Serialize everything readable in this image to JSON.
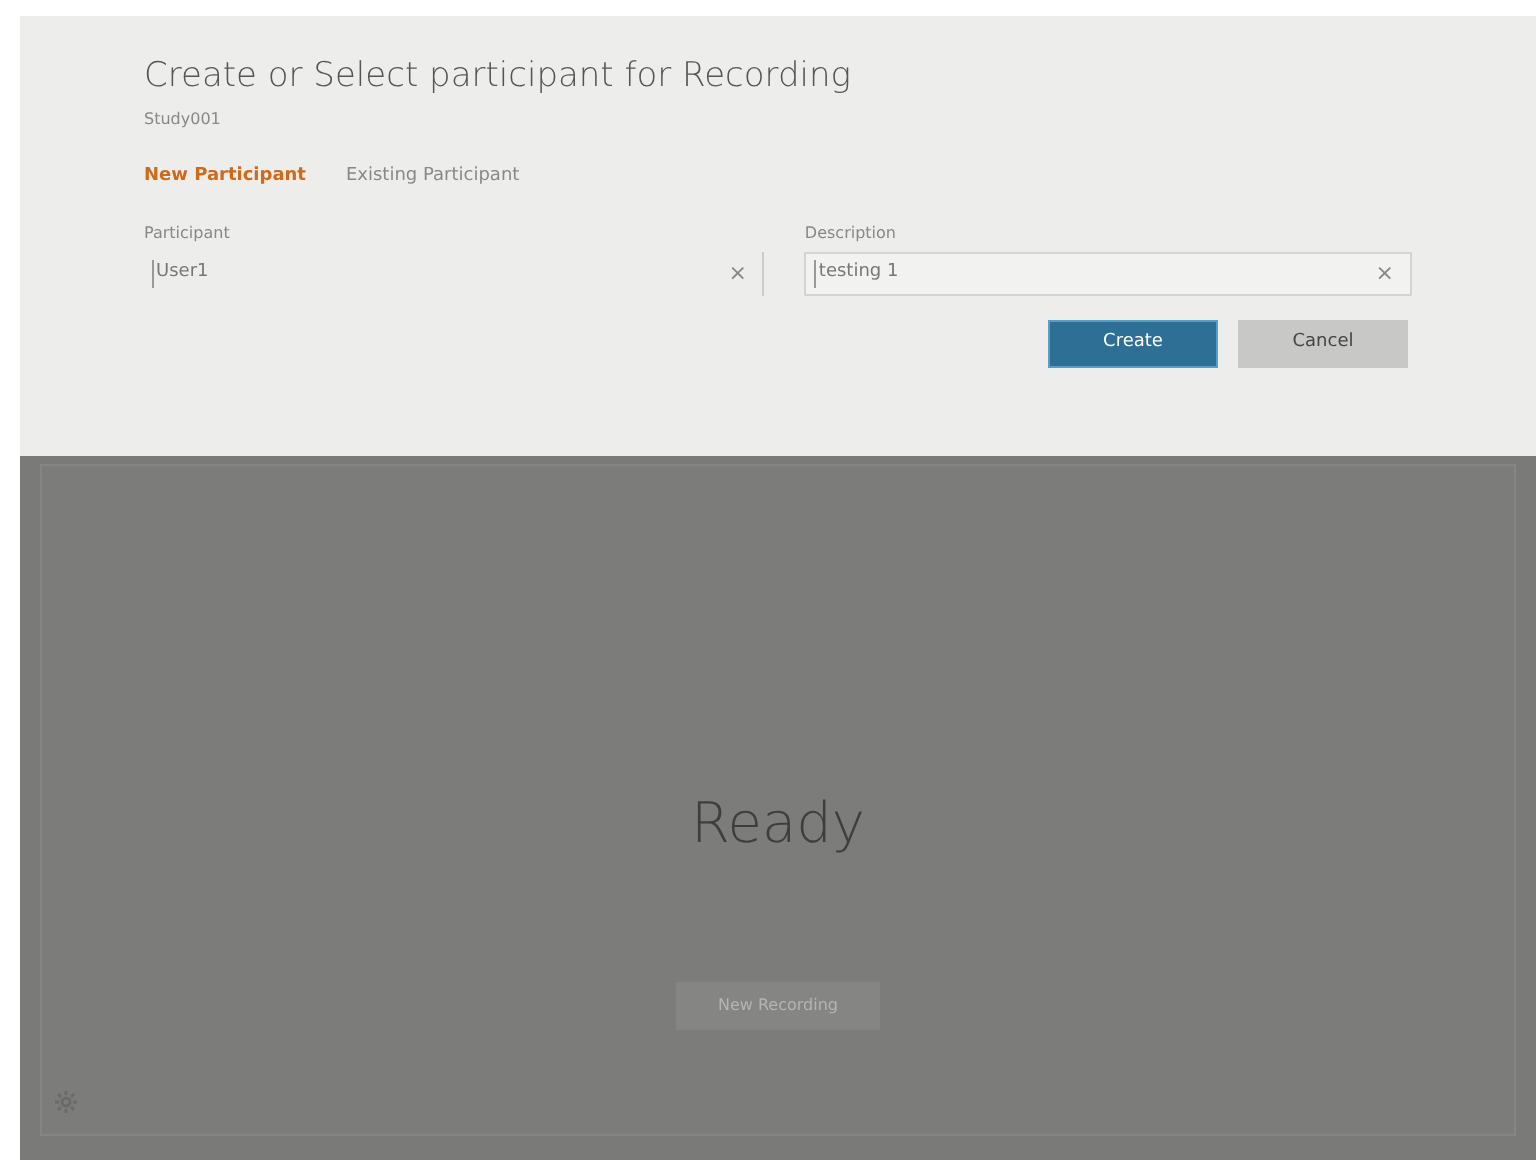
{
  "dialog": {
    "title": "Create or Select participant for Recording",
    "subtitle": "Study001",
    "tabs": [
      {
        "label": "New Participant",
        "selected": true
      },
      {
        "label": "Existing Participant",
        "selected": false
      }
    ],
    "fields": [
      {
        "label": "Participant",
        "value": "User1",
        "clear": "×"
      },
      {
        "label": "Description",
        "value": "testing 1",
        "clear": "×"
      }
    ],
    "buttons": [
      {
        "label": "Create",
        "kind": "primary"
      },
      {
        "label": "Cancel",
        "kind": "secondary"
      }
    ]
  },
  "main": {
    "status": "Ready",
    "button": {
      "label": "New Recording",
      "disabled": true
    }
  }
}
